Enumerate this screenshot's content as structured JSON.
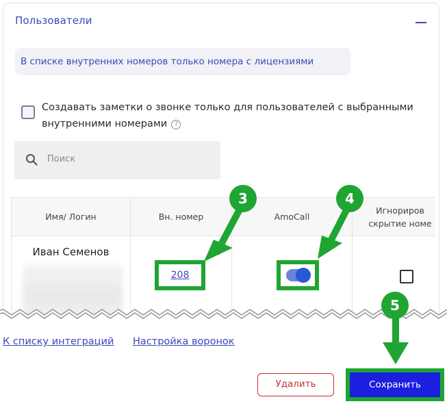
{
  "panel": {
    "title": "Пользователи",
    "notice": "В списке внутренних номеров только номера с лицензиями",
    "checkbox_text": "Создавать заметки о звонке только для пользователей с выбранными внутренними номерами",
    "checkbox_checked": false,
    "help_icon": "?",
    "search_placeholder": "Поиск"
  },
  "table": {
    "headers": [
      "Имя/ Логин",
      "Вн. номер",
      "AmoCall",
      "Игнориров\nскрытие номе"
    ],
    "row": {
      "name": "Иван Семенов",
      "extension": "208",
      "amocall_enabled": true,
      "ignore_checked": false
    }
  },
  "footer": {
    "link_back": "К списку интеграций",
    "link_funnels": "Настройка воронок",
    "delete_label": "Удалить",
    "save_label": "Сохранить"
  },
  "annotations": {
    "badge_3": "3",
    "badge_4": "4",
    "badge_5": "5"
  },
  "colors": {
    "accent": "#3a49b7",
    "highlight": "#1fa532",
    "save_button": "#1c1fe0",
    "delete_border": "#c9302c"
  }
}
